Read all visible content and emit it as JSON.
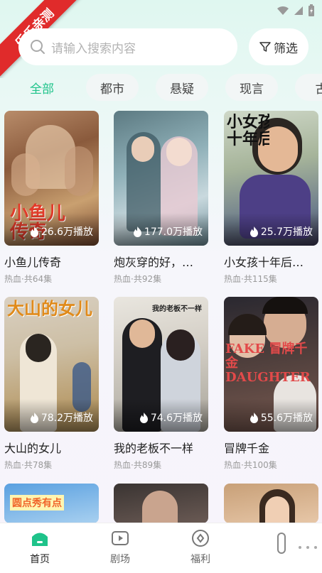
{
  "ribbon_text": "乐乐亲测",
  "search": {
    "placeholder": "请输入搜索内容"
  },
  "filter": {
    "label": "筛选"
  },
  "tabs": [
    {
      "label": "全部",
      "active": true
    },
    {
      "label": "都市",
      "active": false
    },
    {
      "label": "悬疑",
      "active": false
    },
    {
      "label": "现言",
      "active": false
    },
    {
      "label": "古",
      "active": false
    }
  ],
  "dramas": [
    {
      "name": "小鱼儿传奇",
      "meta": "热血·共64集",
      "plays": "26.6万播放",
      "poster_text": "小鱼儿\n传奇"
    },
    {
      "name": "炮灰穿的好，…",
      "meta": "热血·共92集",
      "plays": "177.0万播放",
      "poster_text": ""
    },
    {
      "name": "小女孩十年后…",
      "meta": "热血·共115集",
      "plays": "25.7万播放",
      "poster_text": "小女孩\n十年后报恩"
    },
    {
      "name": "大山的女儿",
      "meta": "热血·共78集",
      "plays": "78.2万播放",
      "poster_text": "大山的女儿"
    },
    {
      "name": "我的老板不一样",
      "meta": "热血·共89集",
      "plays": "74.6万播放",
      "poster_text": "我的老板不一样"
    },
    {
      "name": "冒牌千金",
      "meta": "热血·共100集",
      "plays": "55.6万播放",
      "poster_text": "FAKE 冒牌千金 DAUGHTER"
    }
  ],
  "partial_row": [
    {
      "poster_text": "圆点秀有点"
    },
    {
      "poster_text": ""
    },
    {
      "poster_text": ""
    }
  ],
  "nav": [
    {
      "label": "首页",
      "icon": "home-icon",
      "active": true
    },
    {
      "label": "剧场",
      "icon": "play-icon",
      "active": false
    },
    {
      "label": "福利",
      "icon": "gift-icon",
      "active": false
    }
  ],
  "colors": {
    "accent": "#1ec38a",
    "ribbon": "#e02b2b"
  }
}
